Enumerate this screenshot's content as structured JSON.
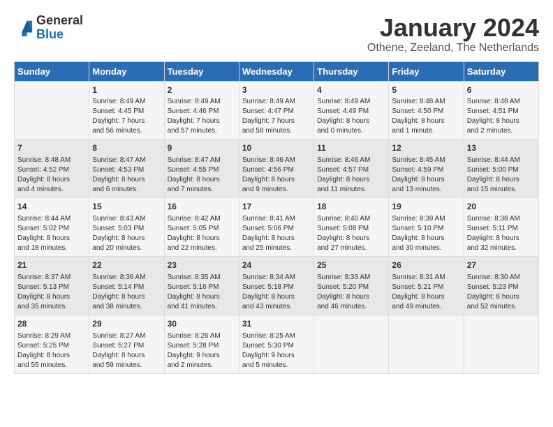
{
  "header": {
    "logo": {
      "general": "General",
      "blue": "Blue"
    },
    "title": "January 2024",
    "subtitle": "Othene, Zeeland, The Netherlands"
  },
  "calendar": {
    "columns": [
      "Sunday",
      "Monday",
      "Tuesday",
      "Wednesday",
      "Thursday",
      "Friday",
      "Saturday"
    ],
    "rows": [
      [
        {
          "day": "",
          "content": ""
        },
        {
          "day": "1",
          "content": "Sunrise: 8:49 AM\nSunset: 4:45 PM\nDaylight: 7 hours\nand 56 minutes."
        },
        {
          "day": "2",
          "content": "Sunrise: 8:49 AM\nSunset: 4:46 PM\nDaylight: 7 hours\nand 57 minutes."
        },
        {
          "day": "3",
          "content": "Sunrise: 8:49 AM\nSunset: 4:47 PM\nDaylight: 7 hours\nand 58 minutes."
        },
        {
          "day": "4",
          "content": "Sunrise: 8:49 AM\nSunset: 4:49 PM\nDaylight: 8 hours\nand 0 minutes."
        },
        {
          "day": "5",
          "content": "Sunrise: 8:48 AM\nSunset: 4:50 PM\nDaylight: 8 hours\nand 1 minute."
        },
        {
          "day": "6",
          "content": "Sunrise: 8:48 AM\nSunset: 4:51 PM\nDaylight: 8 hours\nand 2 minutes."
        }
      ],
      [
        {
          "day": "7",
          "content": "Sunrise: 8:48 AM\nSunset: 4:52 PM\nDaylight: 8 hours\nand 4 minutes."
        },
        {
          "day": "8",
          "content": "Sunrise: 8:47 AM\nSunset: 4:53 PM\nDaylight: 8 hours\nand 6 minutes."
        },
        {
          "day": "9",
          "content": "Sunrise: 8:47 AM\nSunset: 4:55 PM\nDaylight: 8 hours\nand 7 minutes."
        },
        {
          "day": "10",
          "content": "Sunrise: 8:46 AM\nSunset: 4:56 PM\nDaylight: 8 hours\nand 9 minutes."
        },
        {
          "day": "11",
          "content": "Sunrise: 8:46 AM\nSunset: 4:57 PM\nDaylight: 8 hours\nand 11 minutes."
        },
        {
          "day": "12",
          "content": "Sunrise: 8:45 AM\nSunset: 4:59 PM\nDaylight: 8 hours\nand 13 minutes."
        },
        {
          "day": "13",
          "content": "Sunrise: 8:44 AM\nSunset: 5:00 PM\nDaylight: 8 hours\nand 15 minutes."
        }
      ],
      [
        {
          "day": "14",
          "content": "Sunrise: 8:44 AM\nSunset: 5:02 PM\nDaylight: 8 hours\nand 18 minutes."
        },
        {
          "day": "15",
          "content": "Sunrise: 8:43 AM\nSunset: 5:03 PM\nDaylight: 8 hours\nand 20 minutes."
        },
        {
          "day": "16",
          "content": "Sunrise: 8:42 AM\nSunset: 5:05 PM\nDaylight: 8 hours\nand 22 minutes."
        },
        {
          "day": "17",
          "content": "Sunrise: 8:41 AM\nSunset: 5:06 PM\nDaylight: 8 hours\nand 25 minutes."
        },
        {
          "day": "18",
          "content": "Sunrise: 8:40 AM\nSunset: 5:08 PM\nDaylight: 8 hours\nand 27 minutes."
        },
        {
          "day": "19",
          "content": "Sunrise: 8:39 AM\nSunset: 5:10 PM\nDaylight: 8 hours\nand 30 minutes."
        },
        {
          "day": "20",
          "content": "Sunrise: 8:38 AM\nSunset: 5:11 PM\nDaylight: 8 hours\nand 32 minutes."
        }
      ],
      [
        {
          "day": "21",
          "content": "Sunrise: 8:37 AM\nSunset: 5:13 PM\nDaylight: 8 hours\nand 35 minutes."
        },
        {
          "day": "22",
          "content": "Sunrise: 8:36 AM\nSunset: 5:14 PM\nDaylight: 8 hours\nand 38 minutes."
        },
        {
          "day": "23",
          "content": "Sunrise: 8:35 AM\nSunset: 5:16 PM\nDaylight: 8 hours\nand 41 minutes."
        },
        {
          "day": "24",
          "content": "Sunrise: 8:34 AM\nSunset: 5:18 PM\nDaylight: 8 hours\nand 43 minutes."
        },
        {
          "day": "25",
          "content": "Sunrise: 8:33 AM\nSunset: 5:20 PM\nDaylight: 8 hours\nand 46 minutes."
        },
        {
          "day": "26",
          "content": "Sunrise: 8:31 AM\nSunset: 5:21 PM\nDaylight: 8 hours\nand 49 minutes."
        },
        {
          "day": "27",
          "content": "Sunrise: 8:30 AM\nSunset: 5:23 PM\nDaylight: 8 hours\nand 52 minutes."
        }
      ],
      [
        {
          "day": "28",
          "content": "Sunrise: 8:29 AM\nSunset: 5:25 PM\nDaylight: 8 hours\nand 55 minutes."
        },
        {
          "day": "29",
          "content": "Sunrise: 8:27 AM\nSunset: 5:27 PM\nDaylight: 8 hours\nand 59 minutes."
        },
        {
          "day": "30",
          "content": "Sunrise: 8:26 AM\nSunset: 5:28 PM\nDaylight: 9 hours\nand 2 minutes."
        },
        {
          "day": "31",
          "content": "Sunrise: 8:25 AM\nSunset: 5:30 PM\nDaylight: 9 hours\nand 5 minutes."
        },
        {
          "day": "",
          "content": ""
        },
        {
          "day": "",
          "content": ""
        },
        {
          "day": "",
          "content": ""
        }
      ]
    ]
  }
}
